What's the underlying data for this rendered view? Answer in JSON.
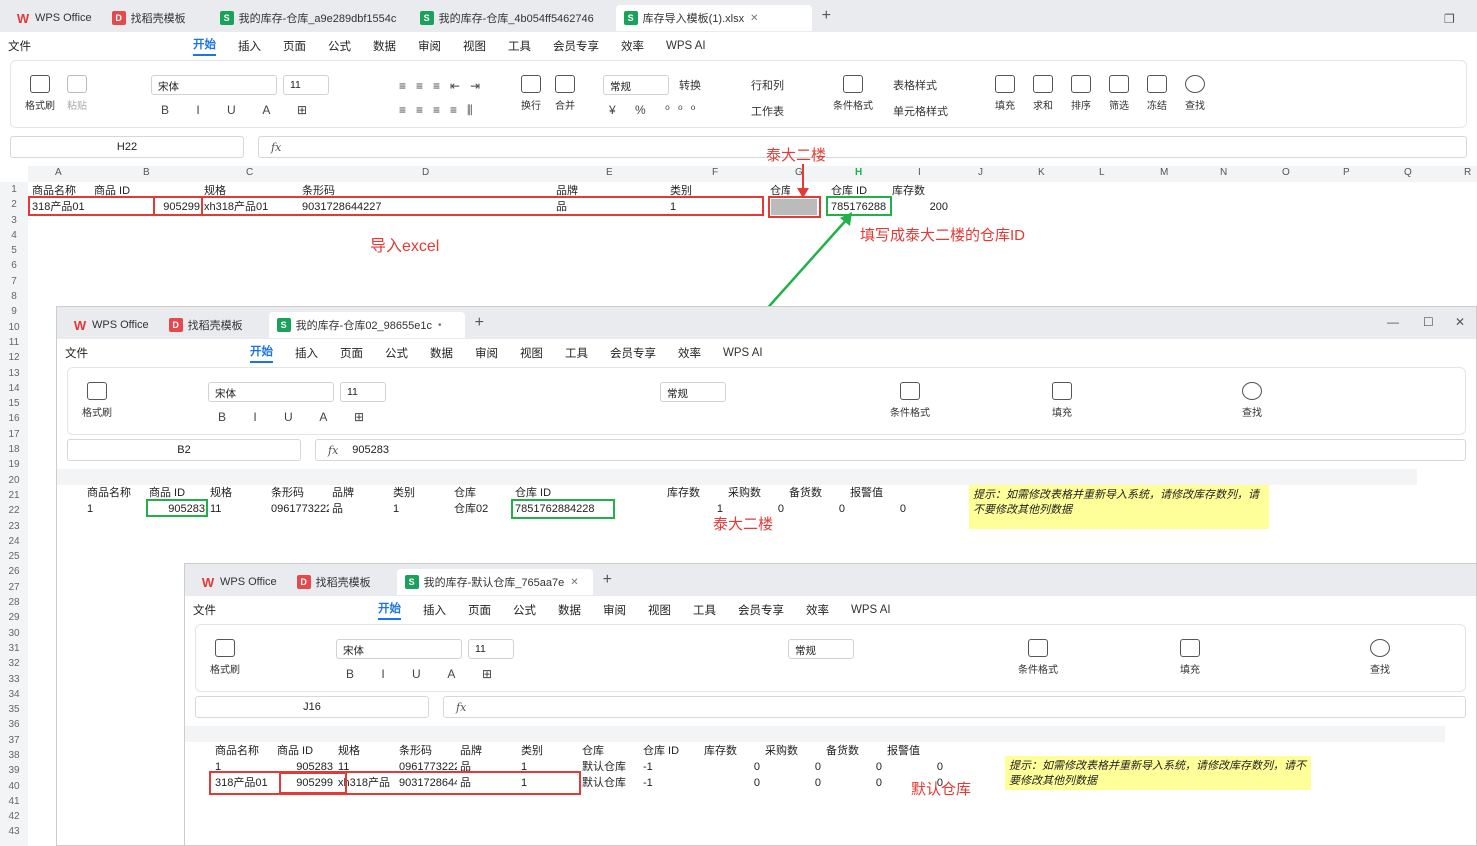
{
  "w1": {
    "tabs": [
      "WPS Office",
      "找稻壳模板",
      "我的库存-仓库_a9e289dbf1554c",
      "我的库存-仓库_4b054ff5462746",
      "库存导入模板(1).xlsx"
    ],
    "menu": [
      "文件",
      "开始",
      "插入",
      "页面",
      "公式",
      "数据",
      "审阅",
      "视图",
      "工具",
      "会员专享",
      "效率",
      "WPS AI"
    ],
    "namebox": "H22",
    "fx_value": "",
    "cols": [
      "A",
      "B",
      "C",
      "D",
      "E",
      "F",
      "G",
      "H",
      "I",
      "J",
      "K",
      "L",
      "M",
      "N",
      "O",
      "P",
      "Q",
      "R"
    ],
    "row1": {
      "a": "商品名称",
      "b": "商品 ID",
      "c": "规格",
      "d": "条形码",
      "e": "品牌",
      "f": "类别",
      "g": "仓库",
      "h": "仓库 ID",
      "i": "库存数"
    },
    "row2": {
      "a": "318产品01",
      "b": "905299",
      "c": "xh318产品01",
      "d": "9031728644227",
      "e": "品",
      "f": "1",
      "h": "785176288",
      "i": "200"
    }
  },
  "w2": {
    "tabs": [
      "WPS Office",
      "找稻壳模板",
      "我的库存-仓库02_98655e1c"
    ],
    "namebox": "B2",
    "fx_value": "905283",
    "row1": {
      "a": "商品名称",
      "b": "商品 ID",
      "c": "规格",
      "d": "条形码",
      "e": "品牌",
      "f": "类别",
      "g": "仓库",
      "h": "仓库 ID",
      "i": "库存数",
      "j": "采购数",
      "k": "备货数",
      "l": "报警值"
    },
    "row2": {
      "a": "1",
      "b": "905283",
      "c": "11",
      "d": "0961773222",
      "e": "品",
      "f": "1",
      "g": "仓库02",
      "h": "7851762884228",
      "i": "1",
      "j": "0",
      "k": "0",
      "l": "0"
    },
    "note": "提示：如需修改表格并重新导入系统，请修改库存数列，请不要修改其他列数据"
  },
  "w3": {
    "tabs": [
      "WPS Office",
      "找稻壳模板",
      "我的库存-默认仓库_765aa7e"
    ],
    "namebox": "J16",
    "fx_value": "",
    "row1": {
      "a": "商品名称",
      "b": "商品 ID",
      "c": "规格",
      "d": "条形码",
      "e": "品牌",
      "f": "类别",
      "g": "仓库",
      "h": "仓库 ID",
      "i": "库存数",
      "j": "采购数",
      "k": "备货数",
      "l": "报警值"
    },
    "row2": {
      "a": "1",
      "b": "905283",
      "c": "11",
      "d": "0961773222",
      "e": "品",
      "f": "1",
      "g": "默认仓库",
      "h": "-1",
      "i": "0",
      "j": "0",
      "k": "0",
      "l": "0"
    },
    "row3": {
      "a": "318产品01",
      "b": "905299",
      "c": "xh318产品",
      "d": "9031728644227",
      "e": "品",
      "f": "1",
      "g": "默认仓库",
      "h": "-1",
      "i": "0",
      "j": "0",
      "k": "0",
      "l": "0"
    },
    "note": "提示：如需修改表格并重新导入系统，请修改库存数列，请不要修改其他列数据"
  },
  "ribbon": {
    "font": "宋体",
    "size": "11",
    "numfmt": "常规",
    "labels": [
      "格式刷",
      "粘贴",
      "换行",
      "合并",
      "转换",
      "行和列",
      "工作表",
      "条件格式",
      "表格样式",
      "单元格样式",
      "填充",
      "求和",
      "排序",
      "筛选",
      "冻结",
      "查找"
    ]
  },
  "annotations": {
    "a1": "泰大二楼",
    "a2": "导入excel",
    "a3": "填写成泰大二楼的仓库ID",
    "a4": "泰大二楼",
    "a5": "默认仓库"
  },
  "leftrows": [
    "1",
    "2",
    "3",
    "4",
    "5",
    "6",
    "7",
    "8",
    "9",
    "10",
    "11",
    "12",
    "13",
    "14",
    "15",
    "16",
    "17",
    "18",
    "19",
    "20",
    "21",
    "22",
    "23",
    "24",
    "25",
    "26",
    "27",
    "28",
    "29",
    "30",
    "31",
    "32",
    "33",
    "34",
    "35",
    "36",
    "37",
    "38",
    "39",
    "40",
    "41",
    "42",
    "43"
  ],
  "colors": {
    "red": "#e53935",
    "green": "#20b248",
    "note": "#ffff99",
    "accent": "#1a73e8"
  }
}
